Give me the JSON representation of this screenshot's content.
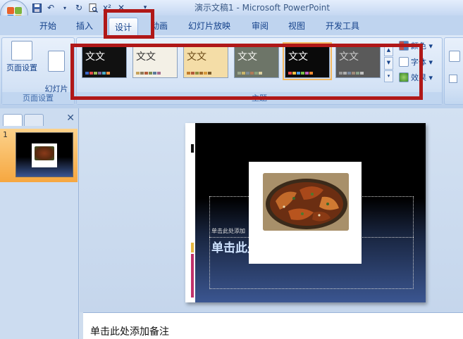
{
  "app": {
    "title": "演示文稿1 - Microsoft PowerPoint"
  },
  "qat": {
    "save_icon": "save-icon",
    "undo_icon": "undo-icon",
    "redo_icon": "redo-icon",
    "preview_icon": "print-preview-icon",
    "superscript": "x²",
    "close_glyph": "✕",
    "more_glyph": "▾"
  },
  "tabs": [
    {
      "label": "开始"
    },
    {
      "label": "插入"
    },
    {
      "label": "设计",
      "active": true
    },
    {
      "label": "动画"
    },
    {
      "label": "幻灯片放映"
    },
    {
      "label": "审阅"
    },
    {
      "label": "视图"
    },
    {
      "label": "开发工具"
    }
  ],
  "ribbon": {
    "page_setup_group": {
      "label": "页面设置",
      "buttons": [
        {
          "label": "页面设置"
        },
        {
          "label": "幻灯片\n方向 ▾"
        }
      ]
    },
    "themes_group": {
      "label": "主题",
      "thumb_text": "文文",
      "themes": [
        {
          "bg": "#111111",
          "fg": "#ffffff",
          "sw": [
            "#3b66c8",
            "#e34a4a",
            "#9bbb59",
            "#8064a2",
            "#4bacc6",
            "#f79646"
          ]
        },
        {
          "bg": "#f3f0e6",
          "fg": "#333333",
          "sw": [
            "#c7a35c",
            "#8e7b5a",
            "#b35c3a",
            "#7d8c51",
            "#5a7a9b",
            "#a56d8e"
          ]
        },
        {
          "bg": "#f4dda7",
          "fg": "#6b4a17",
          "sw": [
            "#c27b2a",
            "#b35a3a",
            "#8c8c3a",
            "#a06a2a",
            "#d79a3a",
            "#7a5a2a"
          ]
        },
        {
          "bg": "#6d7568",
          "fg": "#f4f4f0",
          "sw": [
            "#9ba68a",
            "#c9b56a",
            "#7d8c96",
            "#b07a5a",
            "#8aa07a",
            "#dcd0a0"
          ]
        },
        {
          "bg": "#0a0a0a",
          "fg": "#ffffff",
          "sw": [
            "#e84a4a",
            "#f0c040",
            "#4aa0e8",
            "#7ac04a",
            "#c060c0",
            "#f08a30"
          ],
          "selected": true
        },
        {
          "bg": "#5a5a5a",
          "fg": "#cccccc",
          "sw": [
            "#999999",
            "#b0b0b0",
            "#7a8aa0",
            "#a08a7a",
            "#8aa08a",
            "#c0c0c0"
          ]
        }
      ]
    },
    "options": [
      {
        "label": "颜色 ▾"
      },
      {
        "label": "字体 ▾"
      },
      {
        "label": "效果 ▾"
      }
    ]
  },
  "left_pane": {
    "slide_number": "1",
    "close_glyph": "✕"
  },
  "slide": {
    "subtitle": "单击此处添加",
    "title": "单击此处"
  },
  "notes": {
    "placeholder": "单击此处添加备注"
  },
  "colors": {
    "annotation_red": "#b01818",
    "selected_theme": "#f3b860"
  }
}
